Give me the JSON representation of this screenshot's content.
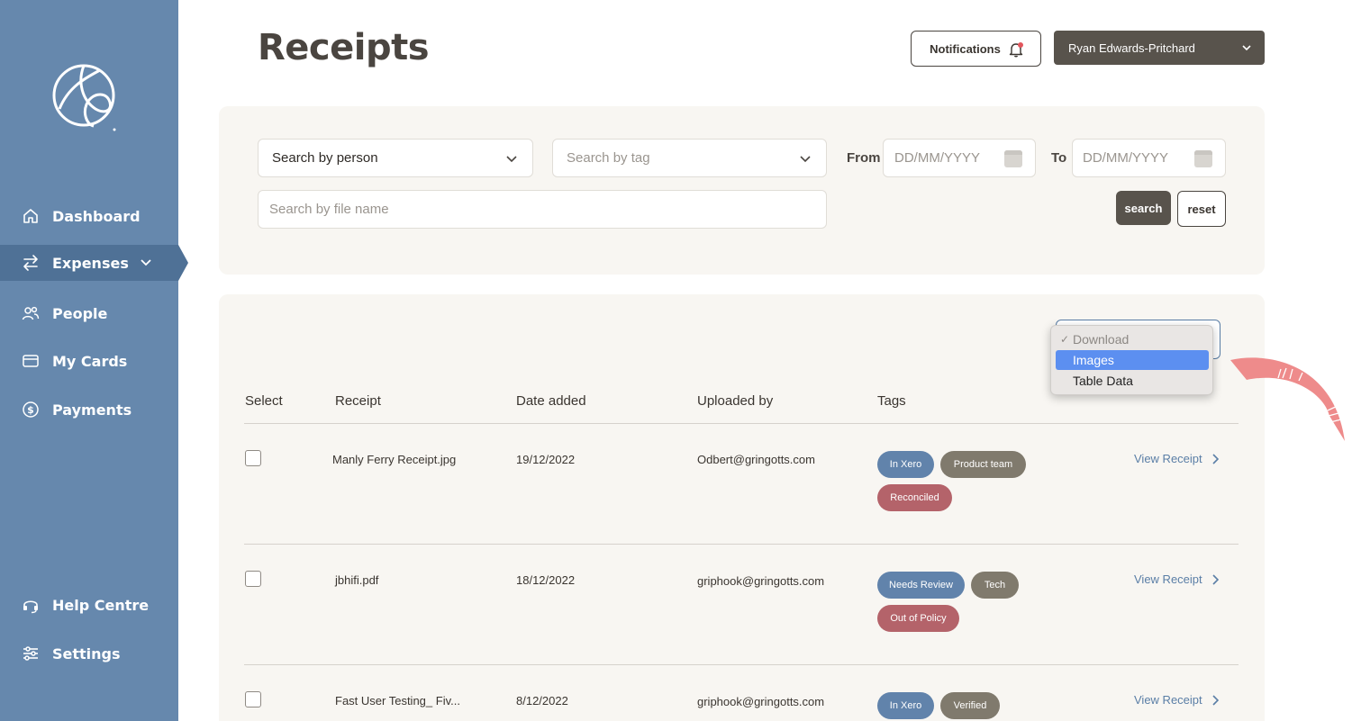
{
  "sidebar": {
    "items": [
      {
        "label": "Dashboard",
        "icon": "home-icon"
      },
      {
        "label": "Expenses",
        "icon": "transfer-arrows-icon"
      },
      {
        "label": "People",
        "icon": "people-icon"
      },
      {
        "label": "My Cards",
        "icon": "card-icon"
      },
      {
        "label": "Payments",
        "icon": "dollar-circle-icon"
      },
      {
        "label": "Help Centre",
        "icon": "headset-icon"
      },
      {
        "label": "Settings",
        "icon": "sliders-icon"
      }
    ],
    "active": "Expenses"
  },
  "header": {
    "title": "Receipts",
    "notifications_label": "Notifications",
    "user_name": "Ryan Edwards-Pritchard"
  },
  "filters": {
    "person_value": "Search by person",
    "tag_placeholder": "Search by tag",
    "from_label": "From",
    "from_placeholder": "DD/MM/YYYY",
    "to_label": "To",
    "to_placeholder": "DD/MM/YYYY",
    "filename_placeholder": "Search by file name",
    "search_label": "search",
    "reset_label": "reset"
  },
  "download_menu": {
    "options": [
      "Download",
      "Images",
      "Table Data"
    ],
    "checked": "Download",
    "highlighted": "Images"
  },
  "table": {
    "columns": [
      "Select",
      "Receipt",
      "Date added",
      "Uploaded by",
      "Tags"
    ],
    "rows": [
      {
        "receipt": "Manly Ferry Receipt.jpg",
        "date": "19/12/2022",
        "uploaded_by": "Odbert@gringotts.com",
        "tags": [
          "In Xero",
          "Product team",
          "Reconciled"
        ],
        "action": "View Receipt"
      },
      {
        "receipt": "jbhifi.pdf",
        "date": "18/12/2022",
        "uploaded_by": "griphook@gringotts.com",
        "tags": [
          "Needs Review",
          "Tech",
          "Out of Policy"
        ],
        "action": "View Receipt"
      },
      {
        "receipt": "Fast User Testing_ Fiv...",
        "date": "8/12/2022",
        "uploaded_by": "griphook@gringotts.com",
        "tags": [
          "In Xero",
          "Verified"
        ],
        "action": "View Receipt"
      }
    ]
  },
  "colors": {
    "sidebar": "#6688ad",
    "sidebar_active": "#4f7196",
    "tag_blue": "#6183ab",
    "tag_grey": "#807a6d",
    "tag_red": "#b4636a",
    "dark_button": "#58534c",
    "panel": "#f8f6f2",
    "menu_highlight": "#5c8ff0",
    "deco_arrow": "#ee8b8b"
  }
}
